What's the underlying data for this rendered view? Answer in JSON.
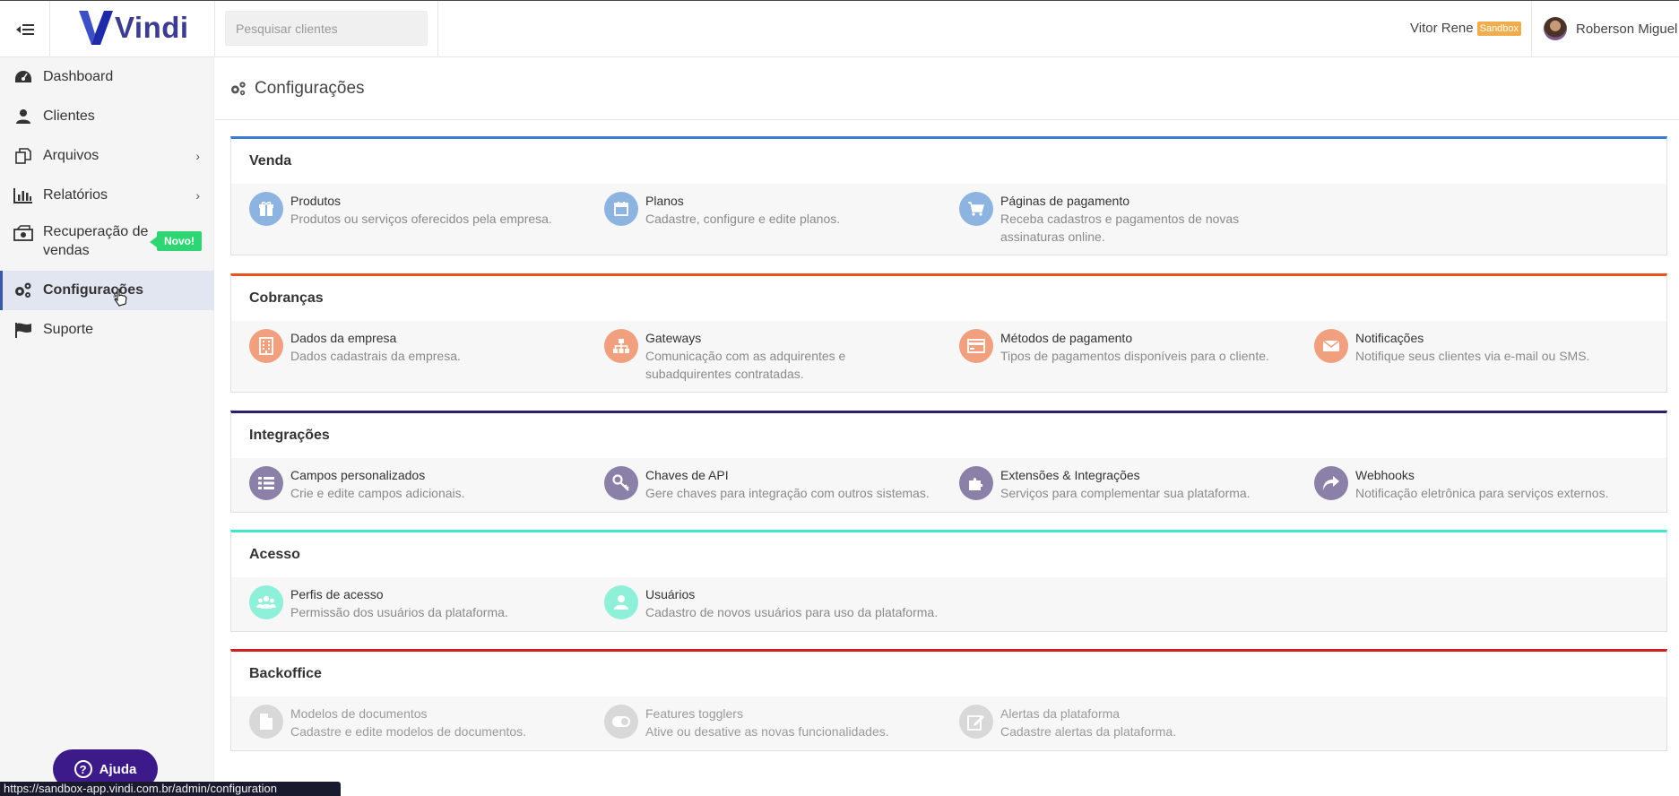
{
  "header": {
    "logo_text": "Vindi",
    "search_placeholder": "Pesquisar clientes",
    "account_name": "Vitor Rene",
    "account_badge": "Sandbox",
    "user_name": "Roberson Miguel"
  },
  "sidebar": {
    "items": [
      {
        "label": "Dashboard",
        "icon": "dashboard-icon"
      },
      {
        "label": "Clientes",
        "icon": "user-icon"
      },
      {
        "label": "Arquivos",
        "icon": "files-icon"
      },
      {
        "label": "Relatórios",
        "icon": "bar-chart-icon"
      },
      {
        "label": "Recuperação de vendas",
        "icon": "money-icon",
        "badge": "Novo!"
      },
      {
        "label": "Configurações",
        "icon": "gears-icon",
        "active": true
      },
      {
        "label": "Suporte",
        "icon": "flag-icon"
      }
    ],
    "help_label": "Ajuda"
  },
  "status_url": "https://sandbox-app.vindi.com.br/admin/configuration",
  "page": {
    "title": "Configurações"
  },
  "sections": [
    {
      "title": "Venda",
      "color": "#3a7bd5",
      "cards": [
        {
          "title": "Produtos",
          "desc": "Produtos ou serviços oferecidos pela empresa.",
          "icon": "gift-icon"
        },
        {
          "title": "Planos",
          "desc": "Cadastre, configure e edite planos.",
          "icon": "calendar-icon"
        },
        {
          "title": "Páginas de pagamento",
          "desc": "Receba cadastros e pagamentos de novas assinaturas online.",
          "icon": "cart-icon"
        }
      ]
    },
    {
      "title": "Cobranças",
      "color": "#e8531f",
      "cards": [
        {
          "title": "Dados da empresa",
          "desc": "Dados cadastrais da empresa.",
          "icon": "building-icon"
        },
        {
          "title": "Gateways",
          "desc": "Comunicação com as adquirentes e subadquirentes contratadas.",
          "icon": "sitemap-icon"
        },
        {
          "title": "Métodos de pagamento",
          "desc": "Tipos de pagamentos disponíveis para o cliente.",
          "icon": "credit-card-icon"
        },
        {
          "title": "Notificações",
          "desc": "Notifique seus clientes via e-mail ou SMS.",
          "icon": "envelope-icon"
        }
      ]
    },
    {
      "title": "Integrações",
      "color": "#2d1b6b",
      "cards": [
        {
          "title": "Campos personalizados",
          "desc": "Crie e edite campos adicionais.",
          "icon": "list-icon"
        },
        {
          "title": "Chaves de API",
          "desc": "Gere chaves para integração com outros sistemas.",
          "icon": "key-icon"
        },
        {
          "title": "Extensões & Integrações",
          "desc": "Serviços para complementar sua plataforma.",
          "icon": "puzzle-icon"
        },
        {
          "title": "Webhooks",
          "desc": "Notificação eletrônica para serviços externos.",
          "icon": "share-icon"
        }
      ]
    },
    {
      "title": "Acesso",
      "color": "#3de8c8",
      "cards": [
        {
          "title": "Perfis de acesso",
          "desc": "Permissão dos usuários da plataforma.",
          "icon": "users-icon"
        },
        {
          "title": "Usuários",
          "desc": "Cadastro de novos usuários para uso da plataforma.",
          "icon": "user-icon"
        }
      ]
    },
    {
      "title": "Backoffice",
      "color": "#d41f1f",
      "cards": [
        {
          "title": "Modelos de documentos",
          "desc": "Cadastre e edite modelos de documentos.",
          "icon": "document-icon"
        },
        {
          "title": "Features togglers",
          "desc": "Ative ou desative as novas funcionalidades.",
          "icon": "toggle-icon"
        },
        {
          "title": "Alertas da plataforma",
          "desc": "Cadastre alertas da plataforma.",
          "icon": "edit-icon"
        }
      ]
    }
  ]
}
